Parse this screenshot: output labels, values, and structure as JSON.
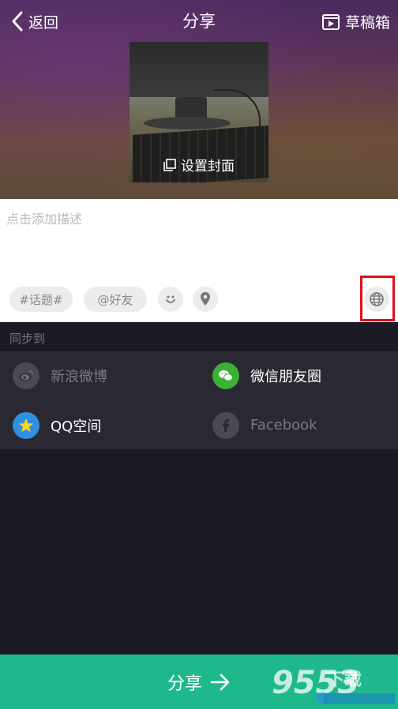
{
  "header": {
    "back_label": "返回",
    "title": "分享",
    "drafts_label": "草稿箱"
  },
  "cover": {
    "label": "设置封面"
  },
  "description": {
    "placeholder": "点击添加描述"
  },
  "tags": {
    "topic_label": "#话题#",
    "friend_label": "@好友"
  },
  "sync": {
    "title": "同步到",
    "targets": [
      {
        "label": "新浪微博",
        "icon": "weibo-icon",
        "enabled": false,
        "color": "#6f6e78"
      },
      {
        "label": "微信朋友圈",
        "icon": "wechat-icon",
        "enabled": true,
        "color": "#3cb034"
      },
      {
        "label": "QQ空间",
        "icon": "qzone-icon",
        "enabled": true,
        "color": "#2f8fe0"
      },
      {
        "label": "Facebook",
        "icon": "facebook-icon",
        "enabled": false,
        "color": "#6f6e78"
      }
    ]
  },
  "share_button": {
    "label": "分享"
  },
  "colors": {
    "accent": "#1fb88d",
    "highlight_box": "#e0101a",
    "panel_bg": "#1c1b25"
  }
}
